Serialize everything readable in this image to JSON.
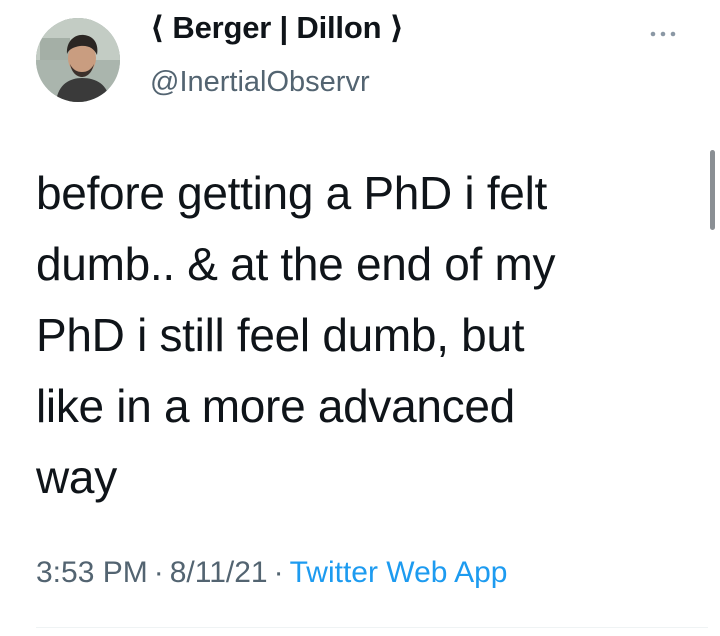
{
  "author": {
    "display_name": "⟨ Berger | Dillon ⟩",
    "handle": "@InertialObservr"
  },
  "tweet": {
    "lines": [
      "before getting a PhD i felt",
      "dumb.. & at the end of my",
      "PhD i still feel dumb, but",
      "like in a more advanced",
      "way"
    ]
  },
  "meta": {
    "time": "3:53 PM",
    "separator": "·",
    "date": "8/11/21",
    "source": "Twitter Web App"
  },
  "icons": {
    "more": "more-options-icon",
    "avatar": "profile-photo"
  },
  "colors": {
    "text": "#0f1419",
    "secondary": "#536471",
    "link": "#1d9bf0"
  }
}
